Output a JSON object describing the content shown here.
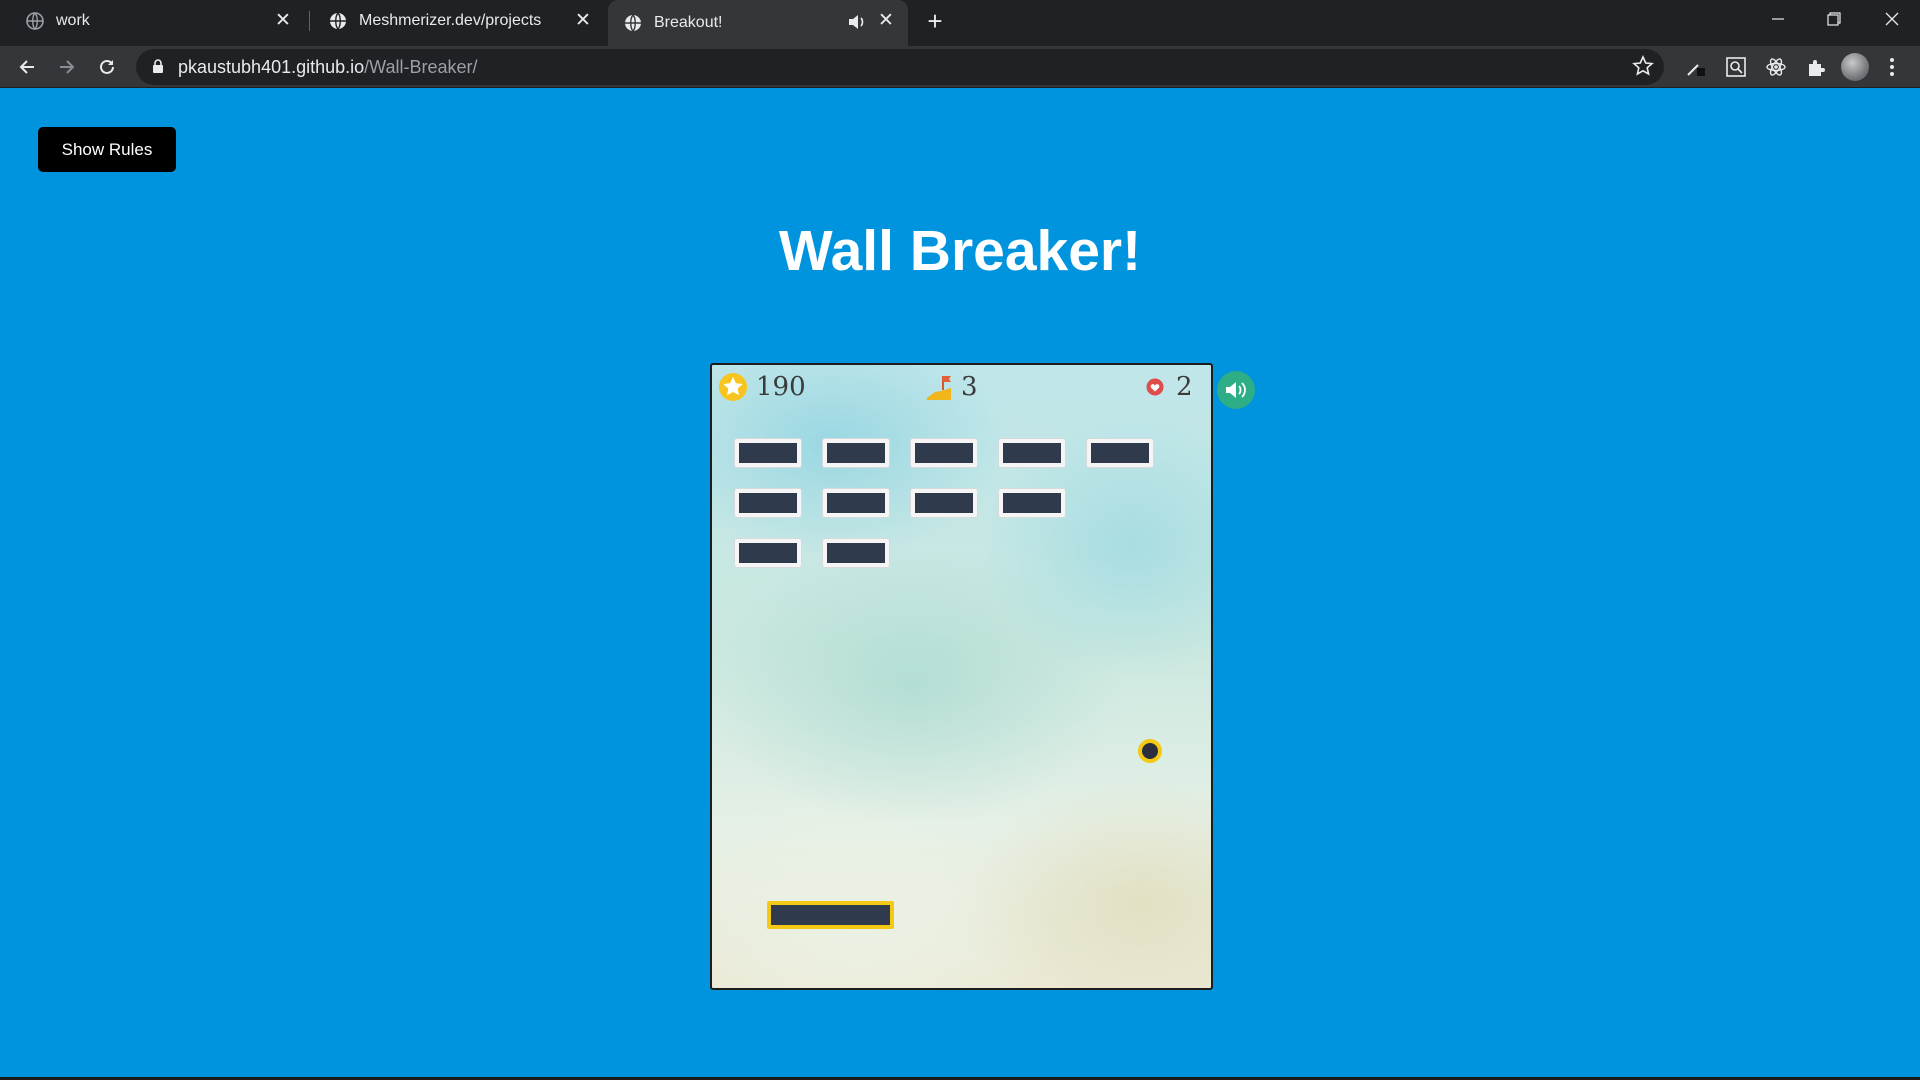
{
  "browser": {
    "tabs": [
      {
        "title": "work"
      },
      {
        "title": "Meshmerizer.dev/projects"
      },
      {
        "title": "Breakout!"
      }
    ],
    "url": {
      "host": "pkaustubh401.github.io",
      "path": "/Wall-Breaker/"
    }
  },
  "page": {
    "rules_button": "Show Rules",
    "title": "Wall Breaker!"
  },
  "game": {
    "score": "190",
    "level": "3",
    "lives": "2",
    "bricks": {
      "columns": 5,
      "rows_remaining": [
        5,
        4,
        2
      ],
      "remaining_count": 11
    },
    "colors": {
      "brick": "#2f3a4c",
      "paddle_border": "#f4c914",
      "sound_button": "#2eae86",
      "page_background": "#0094de"
    },
    "icons": [
      "star-icon",
      "level-flag-icon",
      "heart-icon",
      "speaker-icon"
    ]
  }
}
